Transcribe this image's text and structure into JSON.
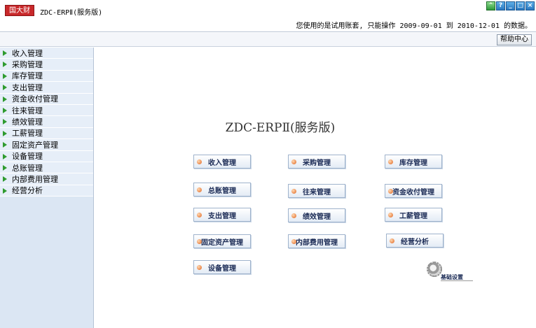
{
  "header": {
    "logo": "国大财",
    "title": "ZDC-ERPⅡ(服务版)",
    "trial_notice": "您使用的是试用账套, 只能操作 2009-09-01 到 2010-12-01 的数据。"
  },
  "window_controls": [
    "⌃",
    "?",
    "_",
    "□",
    "×"
  ],
  "toolbar": {
    "help_label": "帮助中心"
  },
  "sidebar": {
    "items": [
      {
        "label": "收入管理"
      },
      {
        "label": "采购管理"
      },
      {
        "label": "库存管理"
      },
      {
        "label": "支出管理"
      },
      {
        "label": "资金收付管理"
      },
      {
        "label": "往来管理"
      },
      {
        "label": "绩效管理"
      },
      {
        "label": "工薪管理"
      },
      {
        "label": "固定资产管理"
      },
      {
        "label": "设备管理"
      },
      {
        "label": "总账管理"
      },
      {
        "label": "内部费用管理"
      },
      {
        "label": "经营分析"
      }
    ]
  },
  "main": {
    "title": "ZDC-ERPⅡ(服务版)",
    "buttons": [
      {
        "label": "收入管理"
      },
      {
        "label": "采购管理"
      },
      {
        "label": "库存管理"
      },
      {
        "label": "总账管理"
      },
      {
        "label": "往来管理"
      },
      {
        "label": "资金收付管理"
      },
      {
        "label": "支出管理"
      },
      {
        "label": "绩效管理"
      },
      {
        "label": "工薪管理"
      },
      {
        "label": "固定资产管理"
      },
      {
        "label": "内部费用管理"
      },
      {
        "label": "经营分析"
      },
      {
        "label": "设备管理"
      }
    ],
    "basic_settings_label": "基础设置"
  }
}
